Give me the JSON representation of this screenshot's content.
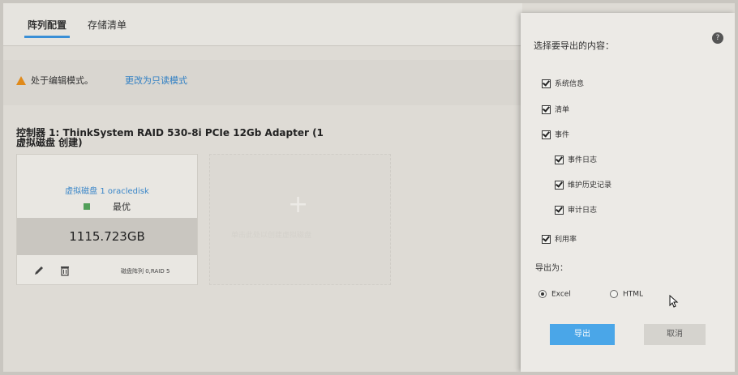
{
  "tabs": [
    {
      "label": "阵列配置",
      "active": true
    },
    {
      "label": "存储清单",
      "active": false
    }
  ],
  "notice": {
    "text": "处于编辑模式。",
    "link": "更改为只读模式",
    "icon": "warning-icon"
  },
  "controller": {
    "title": "控制器 1: ThinkSystem RAID 530-8i PCIe 12Gb Adapter (1 虚拟磁盘 创建)"
  },
  "virtual_disk": {
    "name": "虚拟磁盘 1 oracledisk",
    "status": "最优",
    "status_color": "#52a05a",
    "capacity": "1115.723GB",
    "raid": "磁盘阵列 0,RAID 5"
  },
  "add_card": {
    "text": "单击此处以创建虚拟磁盘"
  },
  "dialog": {
    "title": "选择要导出的内容：",
    "items": [
      {
        "label": "系统信息",
        "checked": true
      },
      {
        "label": "清单",
        "checked": true
      },
      {
        "label": "事件",
        "checked": true
      },
      {
        "label": "事件日志",
        "checked": true
      },
      {
        "label": "维护历史记录",
        "checked": true
      },
      {
        "label": "审计日志",
        "checked": true
      },
      {
        "label": "利用率",
        "checked": true
      }
    ],
    "export_as": "导出为：",
    "formats": [
      {
        "label": "Excel",
        "selected": true
      },
      {
        "label": "HTML",
        "selected": false
      }
    ],
    "export_button": "导出",
    "cancel_button": "取消",
    "accent_color": "#4aa6e8"
  }
}
